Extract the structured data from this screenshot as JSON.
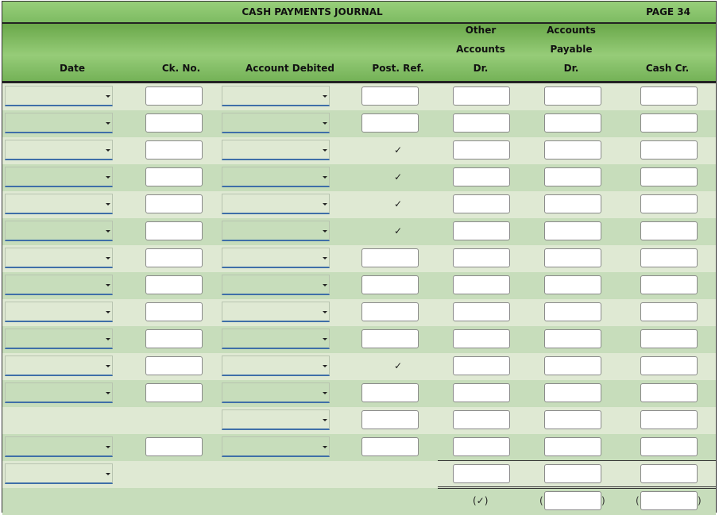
{
  "journal": {
    "title": "CASH PAYMENTS JOURNAL",
    "page_label": "PAGE 34"
  },
  "columns": {
    "date": "Date",
    "ck_no": "Ck. No.",
    "account_debited": "Account Debited",
    "post_ref": "Post. Ref.",
    "other_accounts": [
      "Other",
      "Accounts",
      "Dr."
    ],
    "accounts_payable": [
      "Accounts",
      "Payable",
      "Dr."
    ],
    "cash_cr": "Cash Cr."
  },
  "check_mark": "✓",
  "total_check_mark": "(✓)",
  "paren_open": "(",
  "paren_close": ")",
  "rows": [
    {
      "date": true,
      "ck": true,
      "acct": true,
      "post": "input",
      "other": true,
      "ap": true,
      "cash": true
    },
    {
      "date": true,
      "ck": true,
      "acct": true,
      "post": "input",
      "other": true,
      "ap": true,
      "cash": true
    },
    {
      "date": true,
      "ck": true,
      "acct": true,
      "post": "check",
      "other": true,
      "ap": true,
      "cash": true
    },
    {
      "date": true,
      "ck": true,
      "acct": true,
      "post": "check",
      "other": true,
      "ap": true,
      "cash": true
    },
    {
      "date": true,
      "ck": true,
      "acct": true,
      "post": "check",
      "other": true,
      "ap": true,
      "cash": true
    },
    {
      "date": true,
      "ck": true,
      "acct": true,
      "post": "check",
      "other": true,
      "ap": true,
      "cash": true
    },
    {
      "date": true,
      "ck": true,
      "acct": true,
      "post": "input",
      "other": true,
      "ap": true,
      "cash": true
    },
    {
      "date": true,
      "ck": true,
      "acct": true,
      "post": "input",
      "other": true,
      "ap": true,
      "cash": true
    },
    {
      "date": true,
      "ck": true,
      "acct": true,
      "post": "input",
      "other": true,
      "ap": true,
      "cash": true
    },
    {
      "date": true,
      "ck": true,
      "acct": true,
      "post": "input",
      "other": true,
      "ap": true,
      "cash": true
    },
    {
      "date": true,
      "ck": true,
      "acct": true,
      "post": "check",
      "other": true,
      "ap": true,
      "cash": true
    },
    {
      "date": true,
      "ck": true,
      "acct": true,
      "post": "input",
      "other": true,
      "ap": true,
      "cash": true
    },
    {
      "date": false,
      "ck": false,
      "acct": true,
      "post": "input",
      "other": true,
      "ap": true,
      "cash": true
    },
    {
      "date": true,
      "ck": true,
      "acct": true,
      "post": "input",
      "other": true,
      "ap": true,
      "cash": true
    },
    {
      "date": true,
      "ck": false,
      "acct": false,
      "post": "none",
      "other": true,
      "ap": true,
      "cash": true
    },
    {
      "date": false,
      "ck": false,
      "acct": false,
      "post": "none",
      "other": "totalcheck",
      "ap": "paren",
      "cash": "paren"
    }
  ]
}
